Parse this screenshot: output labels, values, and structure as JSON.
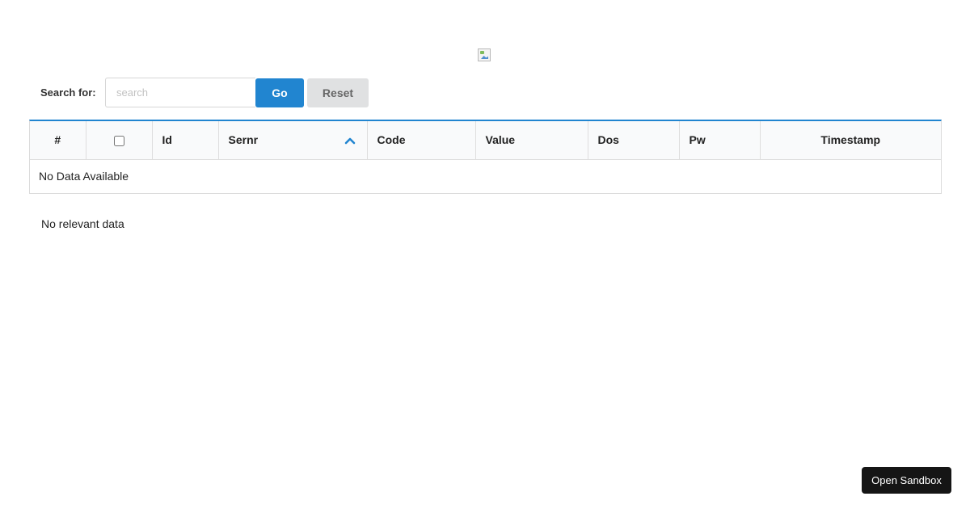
{
  "search": {
    "label": "Search for:",
    "placeholder": "search",
    "value": "",
    "go_label": "Go",
    "reset_label": "Reset"
  },
  "table": {
    "columns": {
      "index": "#",
      "id": "Id",
      "sernr": "Sernr",
      "code": "Code",
      "value": "Value",
      "dos": "Dos",
      "pw": "Pw",
      "timestamp": "Timestamp"
    },
    "sort_column": "Sernr",
    "sort_direction": "ascending",
    "empty_message": "No Data Available"
  },
  "footer_message": "No relevant data",
  "sandbox": {
    "label": "Open Sandbox"
  },
  "colors": {
    "accent": "#2185d0",
    "header_bg": "#f9fafb",
    "reset_bg": "#e0e1e2",
    "sandbox_bg": "#151515"
  }
}
